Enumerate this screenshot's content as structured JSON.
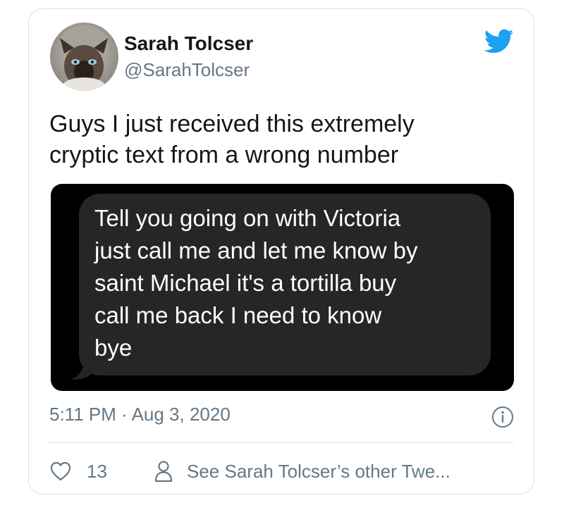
{
  "author": {
    "display_name": "Sarah Tolcser",
    "handle": "@SarahTolcser"
  },
  "tweet": {
    "text_lines": [
      "Guys I just received this extremely",
      "cryptic text from a wrong number"
    ],
    "timestamp": "5:11 PM · Aug 3, 2020"
  },
  "media": {
    "message_lines": [
      "Tell you going on with Victoria",
      "just call me and let me know by",
      "saint Michael it's a tortilla buy",
      "call me back I need to know",
      "bye"
    ]
  },
  "actions": {
    "like_count": "13",
    "other_tweets_label": "See Sarah Tolcser’s other Twe..."
  },
  "icons": {
    "brand": "twitter-bird-icon",
    "info": "info-icon",
    "like": "heart-icon",
    "profile": "person-icon"
  },
  "colors": {
    "brand_blue": "#1da1f2",
    "secondary_text": "#657786",
    "primary_text": "#14171a",
    "border": "#d9dfe4",
    "bubble": "#262628"
  }
}
